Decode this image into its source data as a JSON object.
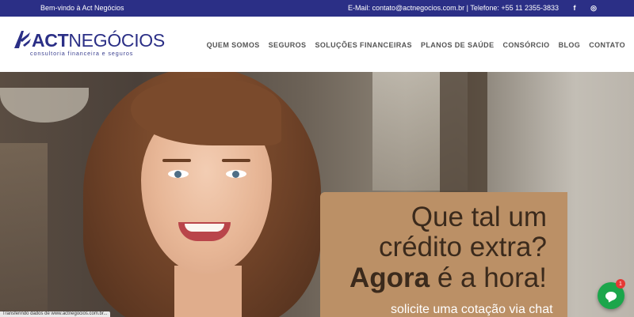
{
  "topbar": {
    "welcome": "Bem-vindo à Act Negócios",
    "contact": "E-Mail: contato@actnegocios.com.br | Telefone: +55 11 2355-3833",
    "social": [
      {
        "icon": "facebook-icon",
        "glyph": "f"
      },
      {
        "icon": "instagram-icon",
        "glyph": "◎"
      }
    ]
  },
  "logo": {
    "brand_bold": "ACT",
    "brand_light": "NEGÓCIOS",
    "tagline": "consultoria financeira e seguros"
  },
  "nav": {
    "items": [
      "QUEM SOMOS",
      "SEGUROS",
      "SOLUÇÕES FINANCEIRAS",
      "PLANOS DE SAÚDE",
      "CONSÓRCIO",
      "BLOG",
      "CONTATO"
    ]
  },
  "hero": {
    "line1": "Que tal um",
    "line2": "crédito extra?",
    "line3_bold": "Agora",
    "line3_rest": " é a hora!",
    "cta": "solicite uma cotação via chat"
  },
  "chat": {
    "badge": "1"
  },
  "status": {
    "text": "Transferindo dados de www.actnegocios.com.br..."
  },
  "colors": {
    "brand": "#2b2f86",
    "promo_bg": "#bb9066",
    "chat_green": "#1ba64b"
  }
}
